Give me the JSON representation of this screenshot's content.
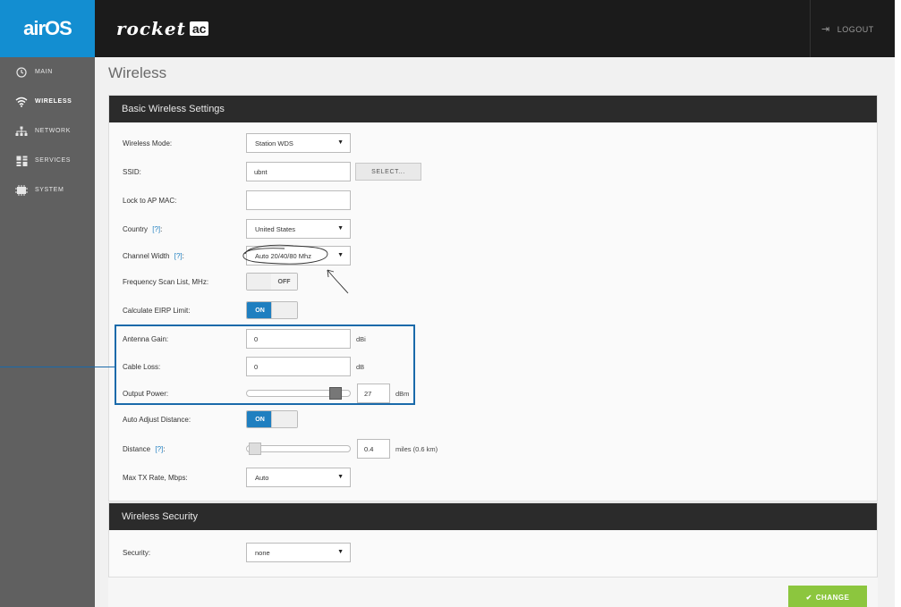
{
  "header": {
    "logo": "airOS",
    "product_name": "rocket",
    "product_badge": "ac",
    "logout_label": "LOGOUT"
  },
  "sidebar": {
    "items": [
      {
        "label": "MAIN",
        "icon": "clock-icon",
        "active": false
      },
      {
        "label": "WIRELESS",
        "icon": "wifi-icon",
        "active": true
      },
      {
        "label": "NETWORK",
        "icon": "network-icon",
        "active": false
      },
      {
        "label": "SERVICES",
        "icon": "services-icon",
        "active": false
      },
      {
        "label": "SYSTEM",
        "icon": "system-icon",
        "active": false
      }
    ]
  },
  "page": {
    "title": "Wireless"
  },
  "basic_section": {
    "title": "Basic Wireless Settings",
    "wireless_mode": {
      "label": "Wireless Mode:",
      "value": "Station WDS"
    },
    "ssid": {
      "label": "SSID:",
      "value": "ubnt",
      "button": "SELECT..."
    },
    "lock_ap_mac": {
      "label": "Lock to AP MAC:",
      "value": ""
    },
    "country": {
      "label": "Country",
      "help": "[?]",
      "suffix": ":",
      "value": "United States"
    },
    "channel_width": {
      "label": "Channel Width",
      "help": "[?]",
      "suffix": ":",
      "value": "Auto 20/40/80 Mhz"
    },
    "freq_scan": {
      "label": "Frequency Scan List, MHz:",
      "state": "OFF"
    },
    "calc_eirp": {
      "label": "Calculate EIRP Limit:",
      "state": "ON"
    },
    "antenna_gain": {
      "label": "Antenna Gain:",
      "value": "0",
      "unit": "dBi"
    },
    "cable_loss": {
      "label": "Cable Loss:",
      "value": "0",
      "unit": "dB"
    },
    "output_power": {
      "label": "Output Power:",
      "value": "27",
      "unit": "dBm",
      "level": 0.9
    },
    "auto_adjust": {
      "label": "Auto Adjust Distance:",
      "state": "ON"
    },
    "distance": {
      "label": "Distance",
      "help": "[?]",
      "suffix": ":",
      "value": "0.4",
      "unit": "miles (0.6 km)",
      "level": 0.03
    },
    "max_tx": {
      "label": "Max TX Rate, Mbps:",
      "value": "Auto"
    }
  },
  "security_section": {
    "title": "Wireless Security",
    "security": {
      "label": "Security:",
      "value": "none"
    }
  },
  "actions": {
    "change_label": "CHANGE"
  },
  "colors": {
    "brand_blue": "#138ed1",
    "toggle_on": "#1f7fc0",
    "change_green": "#8cc63e",
    "highlight": "#1a6aaa"
  }
}
